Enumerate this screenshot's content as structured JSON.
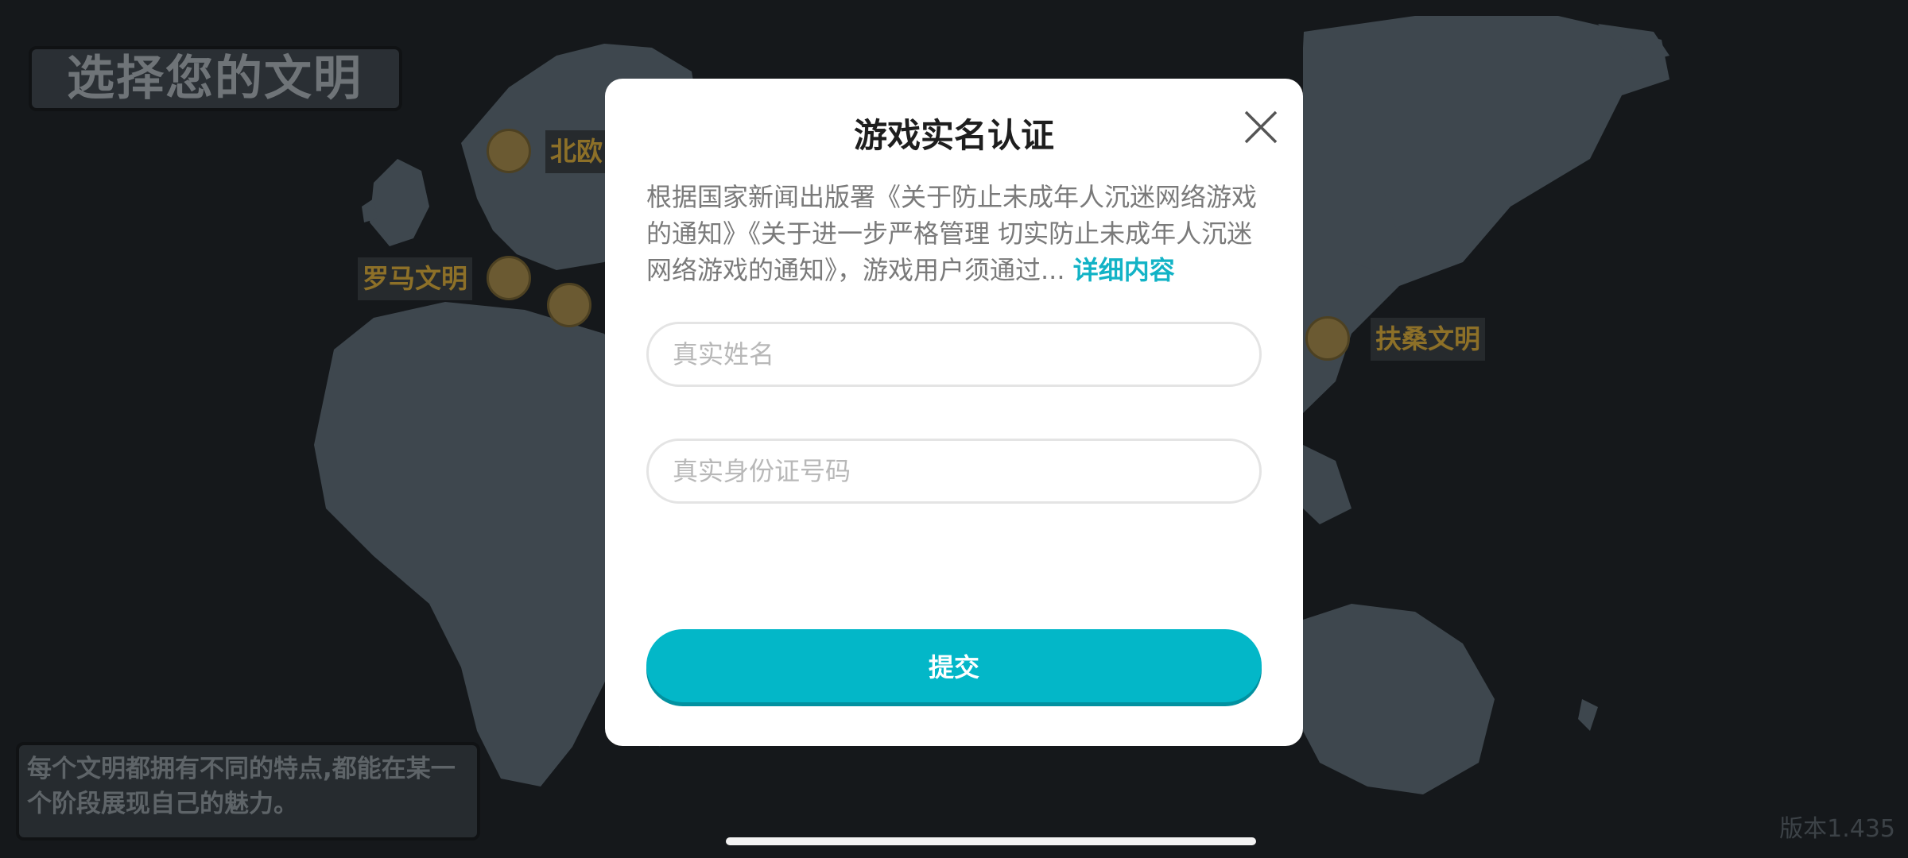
{
  "screen": {
    "title": "选择您的文明",
    "description": "每个文明都拥有不同的特点,都能在某一个阶段展现自己的魅力。",
    "version": "版本1.435",
    "civilizations": {
      "north_europe": "北欧",
      "rome": "罗马文明",
      "fusang": "扶桑文明"
    }
  },
  "dialog": {
    "title": "游戏实名认证",
    "notice_text": "根据国家新闻出版署《关于防止未成年人沉迷网络游戏的通知》《关于进一步严格管理 切实防止未成年人沉迷网络游戏的通知》，游戏用户须通过... ",
    "detail_link": "详细内容",
    "name_placeholder": "真实姓名",
    "id_placeholder": "真实身份证号码",
    "submit_label": "提交"
  },
  "colors": {
    "accent": "#03b7c8",
    "civ_label": "#8d7028",
    "map_land": "#3e474e",
    "background": "#15181b"
  }
}
